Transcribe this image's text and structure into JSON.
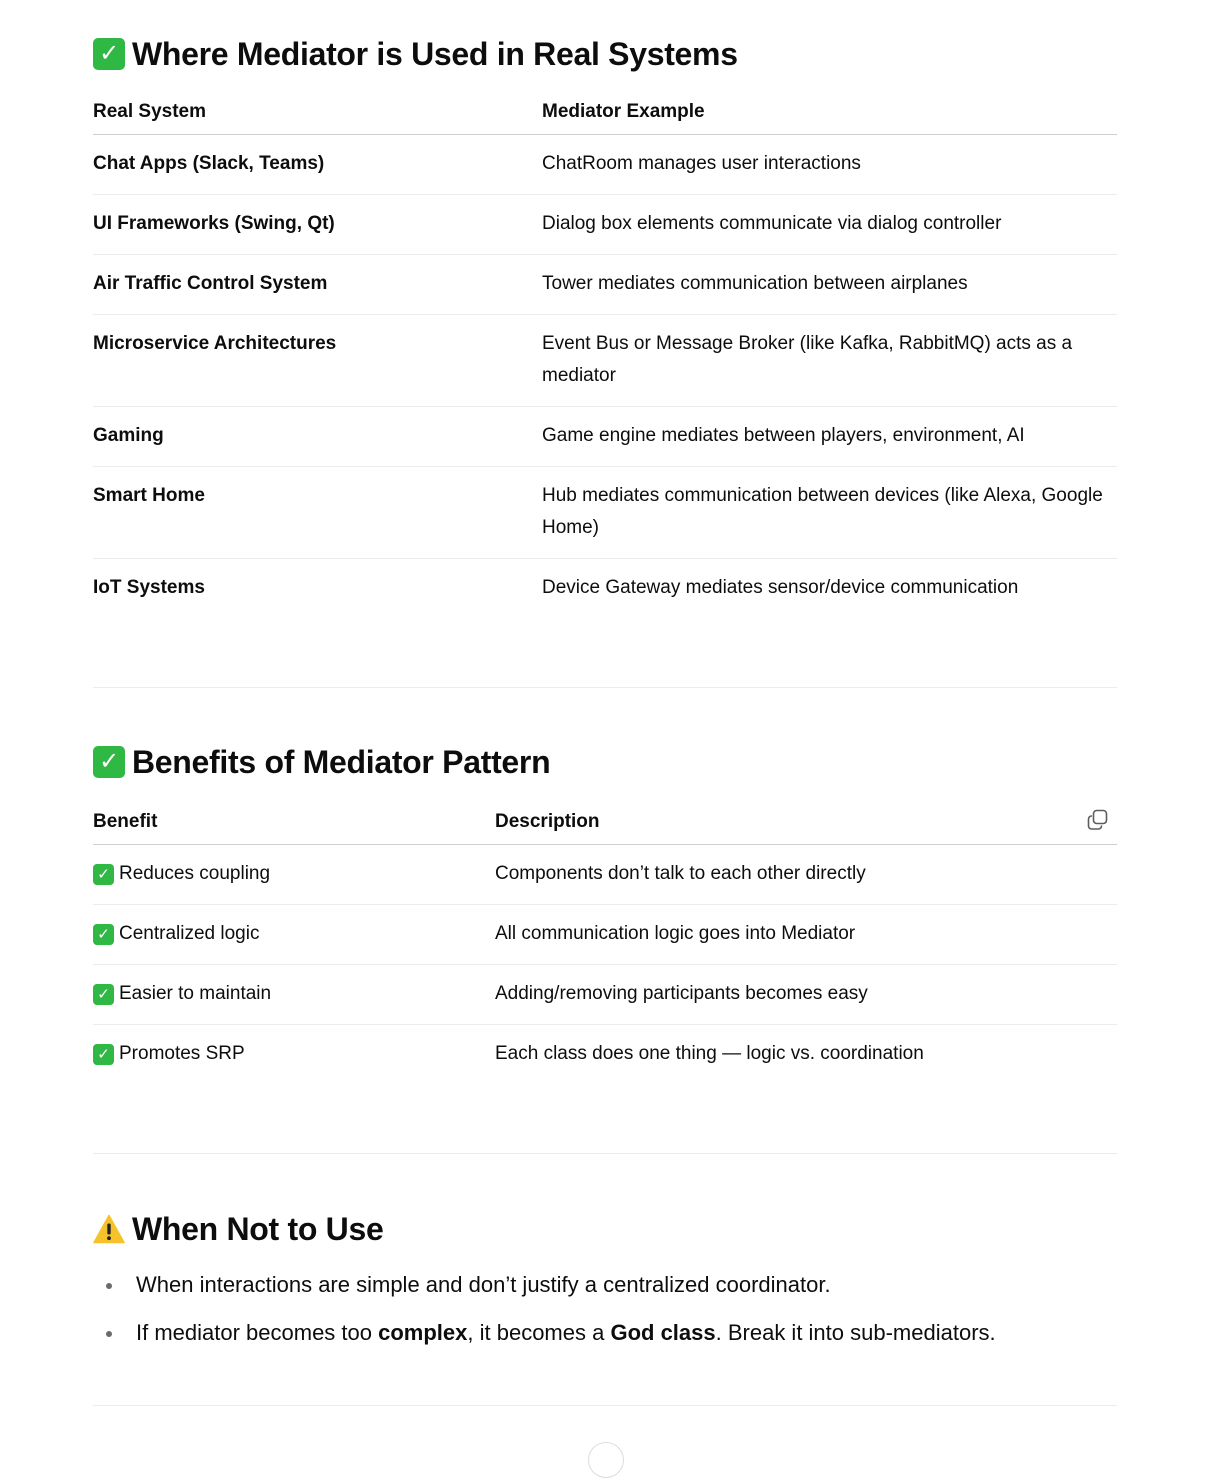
{
  "sections": {
    "real_systems": {
      "icon": "check-mark-button-icon",
      "heading": "Where Mediator is Used in Real Systems",
      "columns": [
        "Real System",
        "Mediator Example"
      ],
      "rows": [
        {
          "system": "Chat Apps (Slack, Teams)",
          "example": "ChatRoom manages user interactions"
        },
        {
          "system": "UI Frameworks (Swing, Qt)",
          "example": "Dialog box elements communicate via dialog controller"
        },
        {
          "system": "Air Traffic Control System",
          "example": "Tower mediates communication between airplanes"
        },
        {
          "system": "Microservice Architectures",
          "example": "Event Bus or Message Broker (like Kafka, RabbitMQ) acts as a mediator"
        },
        {
          "system": "Gaming",
          "example": "Game engine mediates between players, environment, AI"
        },
        {
          "system": "Smart Home",
          "example": "Hub mediates communication between devices (like Alexa, Google Home)"
        },
        {
          "system": "IoT Systems",
          "example": "Device Gateway mediates sensor/device communication"
        }
      ]
    },
    "benefits": {
      "icon": "check-mark-button-icon",
      "heading": "Benefits of Mediator Pattern",
      "columns": [
        "Benefit",
        "Description"
      ],
      "copy_icon": "copy-icon",
      "rows": [
        {
          "check": "✓",
          "benefit": "Reduces coupling",
          "description": "Components don’t talk to each other directly"
        },
        {
          "check": "✓",
          "benefit": "Centralized logic",
          "description": "All communication logic goes into Mediator"
        },
        {
          "check": "✓",
          "benefit": "Easier to maintain",
          "description": "Adding/removing participants becomes easy"
        },
        {
          "check": "✓",
          "benefit": "Promotes SRP",
          "description": "Each class does one thing — logic vs. coordination"
        }
      ]
    },
    "when_not": {
      "icon": "warning-icon",
      "heading": "When Not to Use",
      "bullets": [
        {
          "parts": [
            {
              "text": "When interactions are simple and don’t justify a centralized coordinator.",
              "bold": false
            }
          ]
        },
        {
          "parts": [
            {
              "text": "If mediator becomes too ",
              "bold": false
            },
            {
              "text": "complex",
              "bold": true
            },
            {
              "text": ", it becomes a ",
              "bold": false
            },
            {
              "text": "God class",
              "bold": true
            },
            {
              "text": ". Break it into sub-mediators.",
              "bold": false
            }
          ]
        }
      ]
    }
  },
  "colors": {
    "text": "#0d0d0d",
    "check_green": "#2fb843",
    "warning_yellow": "#f6c22c",
    "divider": "#ececec"
  }
}
